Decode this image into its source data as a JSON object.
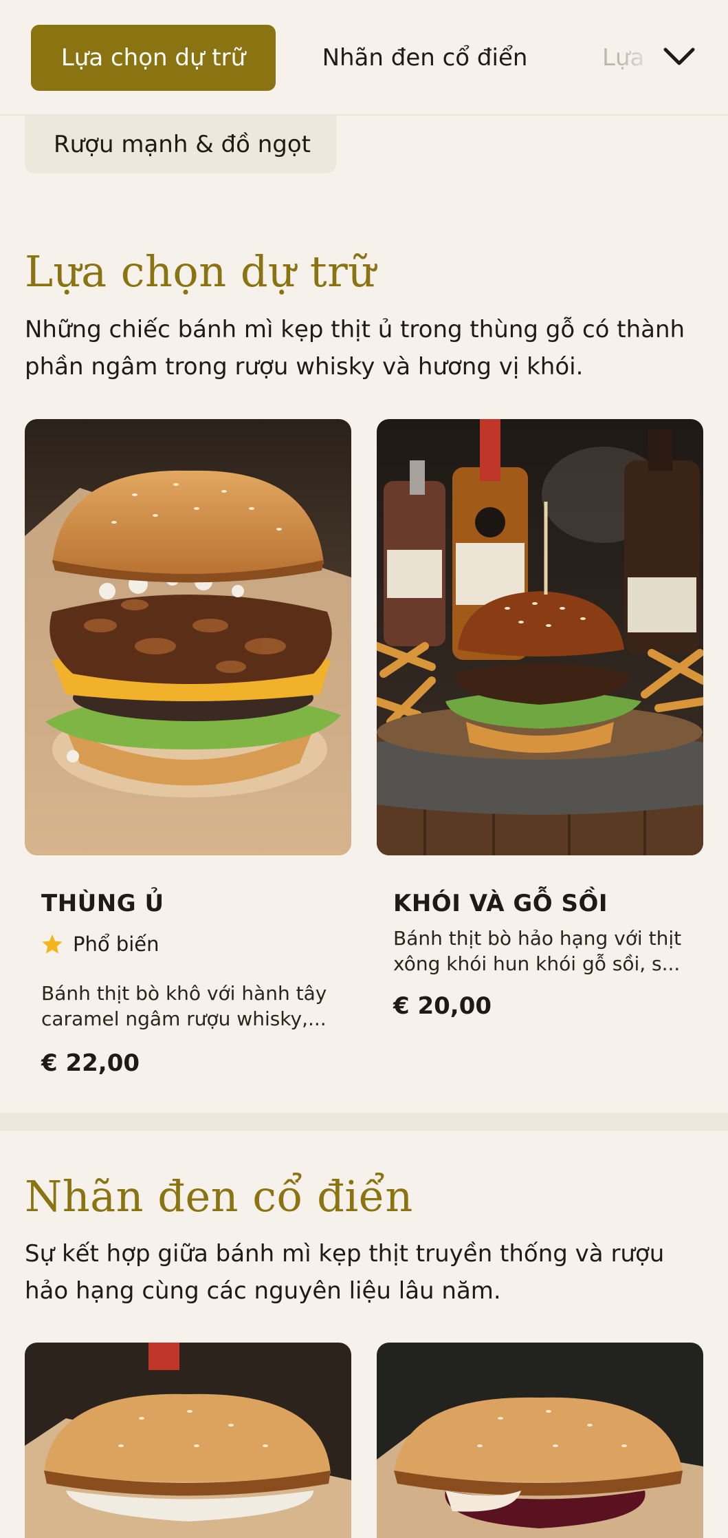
{
  "nav": {
    "tabs": [
      {
        "label": "Lựa chọn dự trữ"
      },
      {
        "label": "Nhãn đen cổ điển"
      },
      {
        "label": "Lựa"
      }
    ],
    "sub_tab": "Rượu mạnh & đồ ngọt",
    "expand_icon": "chevron-down-icon"
  },
  "sections": [
    {
      "title": "Lựa chọn dự trữ",
      "description_lines": [
        "Những chiếc bánh mì kẹp thịt ủ trong thùng gỗ có thành",
        "phần ngâm trong rượu whisky và hương vị khói."
      ],
      "items": [
        {
          "name": "THÙNG Ủ",
          "badge": "Phổ biến",
          "badge_icon": "star-icon",
          "description_lines": [
            "Bánh thịt bò khô với hành tây",
            "caramel ngâm rượu whisky,..."
          ],
          "price": "€ 22,00"
        },
        {
          "name": "KHÓI VÀ GỖ SỒI",
          "description_lines": [
            "Bánh thịt bò hảo hạng với thịt",
            "xông khói hun khói gỗ sồi, s..."
          ],
          "price": "€ 20,00"
        }
      ]
    },
    {
      "title": "Nhãn đen cổ điển",
      "description_lines": [
        "Sự kết hợp giữa bánh mì kẹp thịt truyền thống và rượu",
        "hảo hạng cùng các nguyên liệu lâu năm."
      ]
    }
  ],
  "colors": {
    "accent": "#8a7412",
    "background": "#f6f2eb",
    "star": "#f3b51b"
  }
}
